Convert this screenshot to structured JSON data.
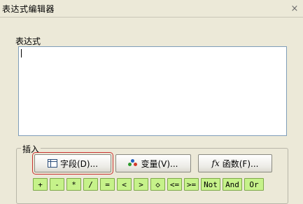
{
  "window": {
    "title": "表达式编辑器",
    "close_glyph": "×"
  },
  "editor": {
    "label": "表达式",
    "value": ""
  },
  "insert": {
    "label": "插入",
    "buttons": {
      "field": "字段(D)...",
      "variable": "变量(V)...",
      "function": "函数(F)..."
    },
    "function_icon_text": "fx",
    "operators": [
      "+",
      "-",
      "*",
      "/",
      "=",
      "<",
      ">",
      "◇",
      "<=",
      ">=",
      "Not",
      "And",
      "Or"
    ]
  },
  "colors": {
    "window_bg": "#ece9d8",
    "operator_bg": "#c6f28a",
    "highlight_outline": "#c83232"
  },
  "icons": {
    "field": "table-icon",
    "variable": "variable-icon",
    "function": "function-icon",
    "close": "close-icon"
  }
}
